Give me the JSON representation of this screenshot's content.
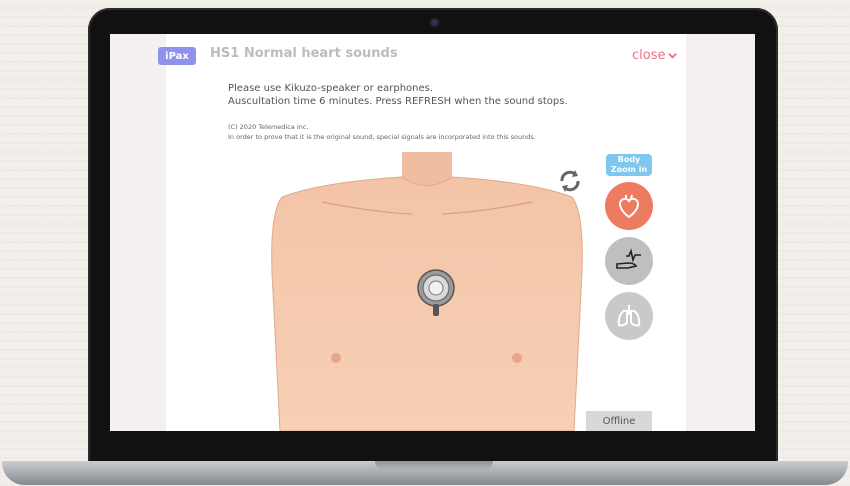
{
  "header": {
    "badge": "iPax",
    "title": "HS1 Normal heart sounds",
    "close_label": "close"
  },
  "instructions": {
    "line1": "Please use Kikuzo-speaker or earphones.",
    "line2": "Auscultation time 6 minutes. Press REFRESH when the sound stops."
  },
  "notice": {
    "copyright": "(C) 2020 Telemedica Inc.",
    "note": "In order to prove that it is the original sound, special signals are incorporated into this sounds."
  },
  "side_panel": {
    "zoom_line1": "Body",
    "zoom_line2": "Zoom in",
    "buttons": [
      {
        "icon": "heart-icon",
        "color": "#ec7b60"
      },
      {
        "icon": "pulse-hand-icon",
        "color": "#bfbfbf"
      },
      {
        "icon": "lungs-icon",
        "color": "#c9c9c9"
      }
    ]
  },
  "footer": {
    "offline_label": "Offline"
  },
  "icons": {
    "refresh": "refresh-icon",
    "stethoscope": "stethoscope-icon"
  },
  "colors": {
    "badge": "#8f93ee",
    "close": "#ee6f86",
    "zoom_label": "#7fc7ee",
    "skin": "#f7c6a8"
  }
}
